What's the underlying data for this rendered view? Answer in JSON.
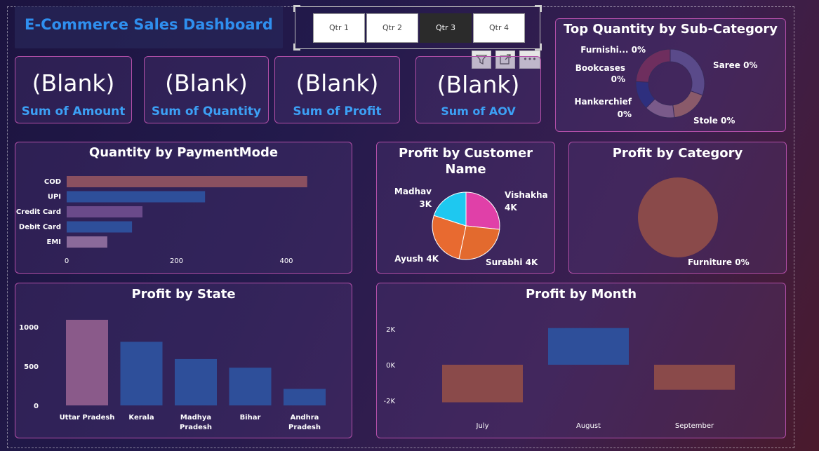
{
  "title": "E-Commerce Sales Dashboard",
  "slicer": {
    "options": [
      "Qtr 1",
      "Qtr 2",
      "Qtr 3",
      "Qtr 4"
    ],
    "selected": "Qtr 3"
  },
  "toolbar": {
    "filter_icon": "filter-icon",
    "focus_icon": "focus-mode-icon",
    "more_label": "•••"
  },
  "kpis": [
    {
      "value": "(Blank)",
      "label": "Sum of Amount"
    },
    {
      "value": "(Blank)",
      "label": "Sum of Quantity"
    },
    {
      "value": "(Blank)",
      "label": "Sum of Profit"
    },
    {
      "value": "(Blank)",
      "label": "Sum of AOV"
    }
  ],
  "colors": {
    "title": "#2f8fef",
    "kpi_label": "#3ca0f5",
    "card_border": "#b24fa8",
    "selected_slicer": "#2b2b2b"
  },
  "chart_data": [
    {
      "id": "subcategory",
      "type": "donut",
      "title": "Top Quantity by Sub-Category",
      "categories": [
        "Saree",
        "Stole",
        "Hankerchief",
        "Bookcases",
        "Furnishi..."
      ],
      "values": [
        0,
        0,
        0,
        0,
        0
      ],
      "labels": [
        "Saree 0%",
        "Stole 0%",
        "Hankerchief 0%",
        "Bookcases 0%",
        "Furnishi... 0%"
      ],
      "colors": [
        "#5a4a8a",
        "#8a5a6a",
        "#7a5a8a",
        "#2e2f7e",
        "#6e2e5e"
      ]
    },
    {
      "id": "paymentmode",
      "type": "bar",
      "orientation": "horizontal",
      "title": "Quantity by PaymentMode",
      "categories": [
        "COD",
        "UPI",
        "Credit Card",
        "Debit Card",
        "EMI"
      ],
      "values": [
        438,
        252,
        138,
        119,
        74
      ],
      "xlim": [
        0,
        460
      ],
      "ticks": [
        0,
        200,
        400
      ],
      "colors": [
        "#8a5060",
        "#2e4f9a",
        "#6a4a8a",
        "#2e4f9a",
        "#8a6a9a"
      ]
    },
    {
      "id": "customer",
      "type": "pie",
      "title": "Profit by Customer Name",
      "categories": [
        "Vishakha",
        "Surabhi",
        "Ayush",
        "Madhav"
      ],
      "values": [
        4,
        4,
        4,
        3
      ],
      "labels": [
        "Vishakha 4K",
        "Surabhi 4K",
        "Ayush 4K",
        "Madhav 3K"
      ],
      "colors": [
        "#e040a8",
        "#e36a2e",
        "#e86a30",
        "#1ec8f0"
      ]
    },
    {
      "id": "category",
      "type": "pie",
      "title": "Profit by Category",
      "categories": [
        "Furniture"
      ],
      "values": [
        0
      ],
      "labels": [
        "Furniture 0%"
      ],
      "colors": [
        "#8a4a4a"
      ]
    },
    {
      "id": "state",
      "type": "bar",
      "orientation": "vertical",
      "title": "Profit by State",
      "categories": [
        "Uttar Pradesh",
        "Kerala",
        "Madhya Pradesh",
        "Bihar",
        "Andhra Pradesh"
      ],
      "values": [
        1090,
        810,
        590,
        480,
        210
      ],
      "ylim": [
        0,
        1150
      ],
      "ticks": [
        0,
        500,
        1000
      ],
      "colors": [
        "#8a5a8a",
        "#2e4f9a",
        "#2e4f9a",
        "#2e4f9a",
        "#2e4f9a"
      ]
    },
    {
      "id": "month",
      "type": "bar",
      "orientation": "vertical",
      "title": "Profit by Month",
      "categories": [
        "July",
        "August",
        "September"
      ],
      "values": [
        -2100,
        2050,
        -1400
      ],
      "ylim": [
        -2500,
        2500
      ],
      "ticks": [
        2000,
        0,
        -2000
      ],
      "tick_labels": [
        "2K",
        "0K",
        "-2K"
      ],
      "colors": [
        "#8a4a4a",
        "#2e4f9a",
        "#8a4a4a"
      ]
    }
  ]
}
